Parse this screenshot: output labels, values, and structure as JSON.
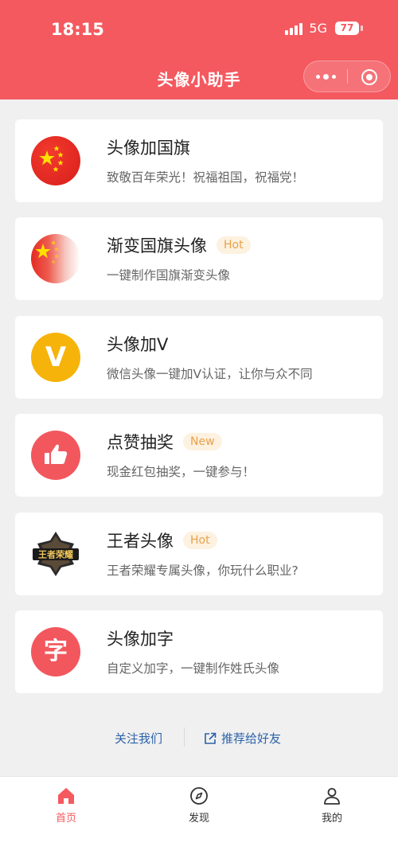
{
  "status_bar": {
    "time": "18:15",
    "network": "5G",
    "battery": "77"
  },
  "nav": {
    "title": "头像小助手"
  },
  "cards": [
    {
      "title": "头像加国旗",
      "subtitle": "致敬百年荣光！祝福祖国，祝福党！",
      "badge": "",
      "icon": "china-flag-icon"
    },
    {
      "title": "渐变国旗头像",
      "subtitle": "一键制作国旗渐变头像",
      "badge": "Hot",
      "icon": "gradient-flag-icon"
    },
    {
      "title": "头像加V",
      "subtitle": "微信头像一键加V认证，让你与众不同",
      "badge": "",
      "icon": "v-badge-icon",
      "icon_text": "V"
    },
    {
      "title": "点赞抽奖",
      "subtitle": "现金红包抽奖，一键参与！",
      "badge": "New",
      "icon": "thumbs-up-icon"
    },
    {
      "title": "王者头像",
      "subtitle": "王者荣耀专属头像，你玩什么职业?",
      "badge": "Hot",
      "icon": "honor-of-kings-logo",
      "icon_text": "王者荣耀"
    },
    {
      "title": "头像加字",
      "subtitle": "自定义加字，一键制作姓氏头像",
      "badge": "",
      "icon": "character-icon",
      "icon_text": "字"
    }
  ],
  "links": {
    "follow": "关注我们",
    "share": "推荐给好友"
  },
  "tabbar": [
    {
      "label": "首页",
      "icon": "home-icon",
      "active": true
    },
    {
      "label": "发现",
      "icon": "compass-icon",
      "active": false
    },
    {
      "label": "我的",
      "icon": "person-icon",
      "active": false
    }
  ],
  "colors": {
    "brand": "#f4595f",
    "link": "#2c62a8",
    "badge_text": "#e8a24a",
    "badge_bg": "#fdf1e0"
  }
}
